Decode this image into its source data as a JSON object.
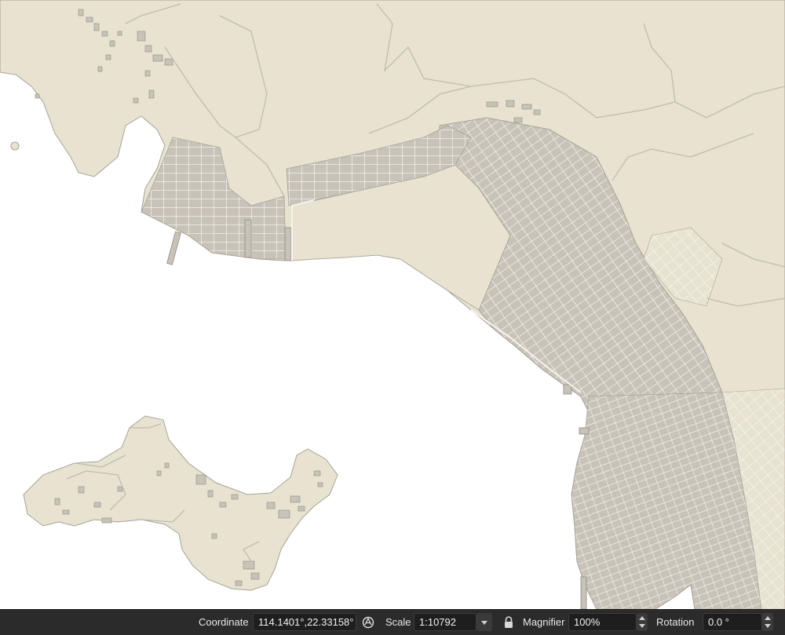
{
  "statusbar": {
    "coordinate_label": "Coordinate",
    "coordinate_value": "114.1401°,22.33158°",
    "scale_label": "Scale",
    "scale_value": "1:10792",
    "magnifier_label": "Magnifier",
    "magnifier_value": "100%",
    "rotation_label": "Rotation",
    "rotation_value": "0.0 °"
  },
  "map": {
    "land_color": "#e8e2d0",
    "water_color": "#ffffff",
    "building_color": "#c8c2b8",
    "road_color": "#f2f0ea"
  },
  "icons": [
    "pan-toggle-icon",
    "lock-icon",
    "chevron-down-icon",
    "spinner-icon"
  ]
}
